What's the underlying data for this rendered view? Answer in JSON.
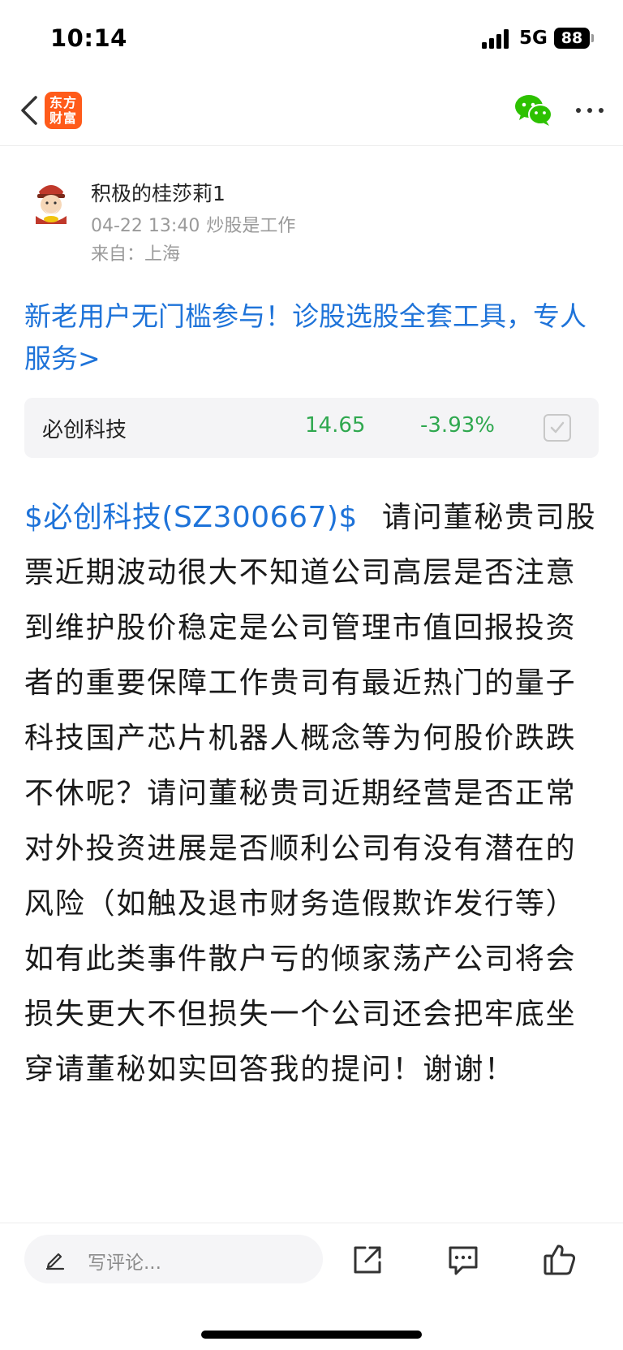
{
  "status_bar": {
    "time": "10:14",
    "network": "5G",
    "battery": "88"
  },
  "nav": {
    "logo_line1": "东方",
    "logo_line2": "财富",
    "back_icon": "chevron-left-icon",
    "share_icon": "wechat-icon",
    "more_icon": "more-dots-icon"
  },
  "author": {
    "name": "积极的桂莎莉1",
    "time": "04-22 13:40",
    "group": "炒股是工作",
    "location": "来自：上海"
  },
  "promo": {
    "text": "新老用户无门槛参与！诊股选股全套工具，专人服务>"
  },
  "stock": {
    "name": "必创科技",
    "price": "14.65",
    "change": "-3.93%",
    "price_color": "#2fa84f"
  },
  "post": {
    "stock_tag": "$必创科技(SZ300667)$",
    "body": "请问董秘贵司股票近期波动很大不知道公司高层是否注意到维护股价稳定是公司管理市值回报投资者的重要保障工作贵司有最近热门的量子科技国产芯片机器人概念等为何股价跌跌不休呢？请问董秘贵司近期经营是否正常对外投资进展是否顺利公司有没有潜在的风险（如触及退市财务造假欺诈发行等）如有此类事件散户亏的倾家荡产公司将会损失更大不但损失一个公司还会把牢底坐穿请董秘如实回答我的提问！谢谢！"
  },
  "bottom_bar": {
    "comment_placeholder": "写评论...",
    "icons": [
      "pen-icon",
      "share-icon",
      "comment-icon",
      "thumbs-up-icon"
    ]
  },
  "colors": {
    "accent": "#1e73d9",
    "down": "#2fa84f",
    "logo": "#ff5b1a",
    "wechat": "#2dc100"
  }
}
